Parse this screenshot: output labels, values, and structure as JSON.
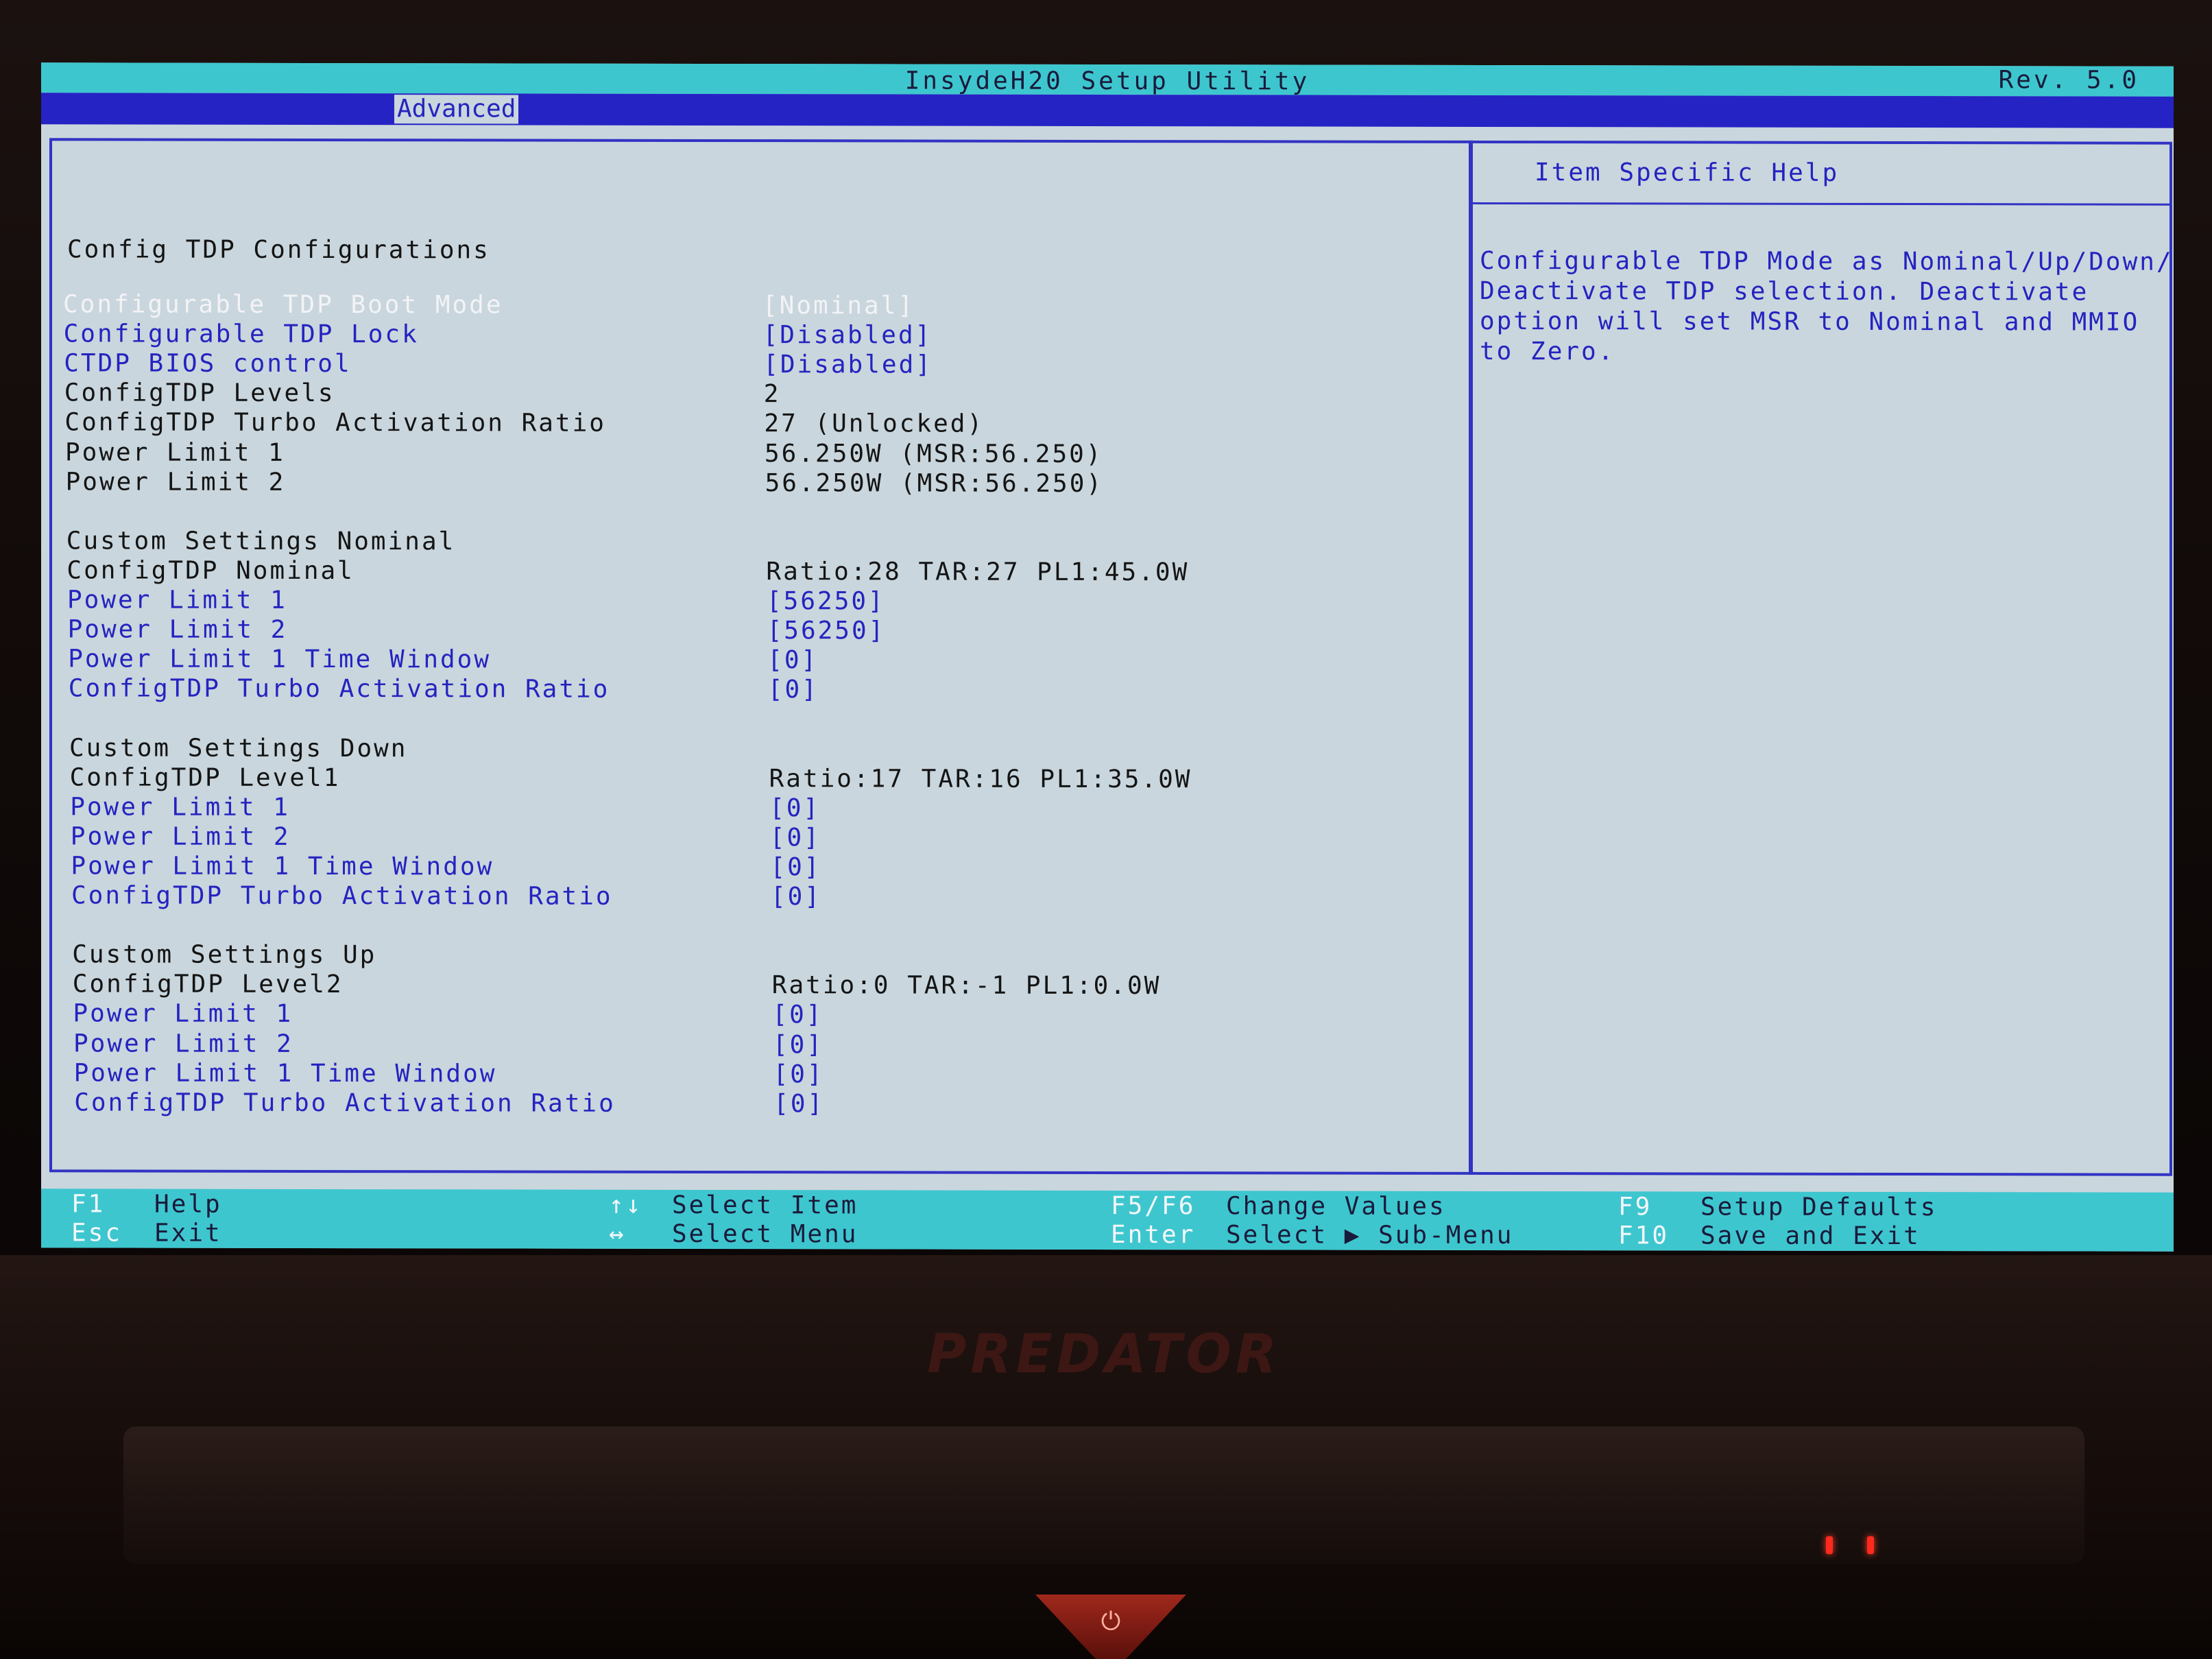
{
  "window": {
    "title": "InsydeH20 Setup Utility",
    "revision": "Rev. 5.0"
  },
  "menu": {
    "active_tab": "Advanced"
  },
  "main": {
    "section_title": "Config TDP Configurations",
    "rows": [
      {
        "label": "Configurable TDP Boot Mode",
        "value": "[Nominal]",
        "kind": "highlight"
      },
      {
        "label": "Configurable TDP Lock",
        "value": "[Disabled]",
        "kind": "option"
      },
      {
        "label": "CTDP BIOS control",
        "value": "[Disabled]",
        "kind": "option"
      },
      {
        "label": "ConfigTDP Levels",
        "value": "2",
        "kind": "info"
      },
      {
        "label": "ConfigTDP Turbo Activation Ratio",
        "value": "27 (Unlocked)",
        "kind": "info"
      },
      {
        "label": "Power Limit 1",
        "value": "56.250W (MSR:56.250)",
        "kind": "info"
      },
      {
        "label": "Power Limit 2",
        "value": "56.250W (MSR:56.250)",
        "kind": "info"
      },
      {
        "label": "",
        "value": "",
        "kind": "blank"
      },
      {
        "label": "Custom Settings Nominal",
        "value": "",
        "kind": "info"
      },
      {
        "label": "ConfigTDP Nominal",
        "value": "Ratio:28 TAR:27 PL1:45.0W",
        "kind": "info"
      },
      {
        "label": "Power Limit 1",
        "value": "[56250]",
        "kind": "option"
      },
      {
        "label": "Power Limit 2",
        "value": "[56250]",
        "kind": "option"
      },
      {
        "label": "Power Limit 1 Time Window",
        "value": "[0]",
        "kind": "option"
      },
      {
        "label": "ConfigTDP Turbo Activation Ratio",
        "value": "[0]",
        "kind": "option"
      },
      {
        "label": "",
        "value": "",
        "kind": "blank"
      },
      {
        "label": "Custom Settings Down",
        "value": "",
        "kind": "info"
      },
      {
        "label": "ConfigTDP Level1",
        "value": "Ratio:17 TAR:16 PL1:35.0W",
        "kind": "info"
      },
      {
        "label": "Power Limit 1",
        "value": "[0]",
        "kind": "option"
      },
      {
        "label": "Power Limit 2",
        "value": "[0]",
        "kind": "option"
      },
      {
        "label": "Power Limit 1 Time Window",
        "value": "[0]",
        "kind": "option"
      },
      {
        "label": "ConfigTDP Turbo Activation Ratio",
        "value": "[0]",
        "kind": "option"
      },
      {
        "label": "",
        "value": "",
        "kind": "blank"
      },
      {
        "label": "Custom Settings Up",
        "value": "",
        "kind": "info"
      },
      {
        "label": "ConfigTDP Level2",
        "value": "Ratio:0 TAR:-1 PL1:0.0W",
        "kind": "info"
      },
      {
        "label": "Power Limit 1",
        "value": "[0]",
        "kind": "option"
      },
      {
        "label": "Power Limit 2",
        "value": "[0]",
        "kind": "option"
      },
      {
        "label": "Power Limit 1 Time Window",
        "value": "[0]",
        "kind": "option"
      },
      {
        "label": "ConfigTDP Turbo Activation Ratio",
        "value": "[0]",
        "kind": "option"
      }
    ]
  },
  "help": {
    "title": "Item Specific Help",
    "lines": [
      "Configurable TDP Mode as Nominal/Up/Down/",
      "Deactivate TDP selection. Deactivate",
      "option will set MSR to Nominal and MMIO",
      "to Zero."
    ]
  },
  "footer": {
    "f1_key": "F1",
    "f1_label": "Help",
    "esc_key": "Esc",
    "esc_label": "Exit",
    "updown_key": "↑↓",
    "updown_label": "Select Item",
    "leftright_key": "↔",
    "leftright_label": "Select Menu",
    "f5f6_key": "F5/F6",
    "f5f6_label": "Change Values",
    "enter_key": "Enter",
    "enter_label": "Select ▶ Sub-Menu",
    "f9_key": "F9",
    "f9_label": "Setup Defaults",
    "f10_key": "F10",
    "f10_label": "Save and Exit"
  },
  "hardware": {
    "brand": "PREDATOR"
  },
  "colors": {
    "screen_bg": "#c9d6dd",
    "title_bar": "#3ec6cf",
    "menu_bar": "#2623c5",
    "option_text": "#2523c0",
    "info_text": "#141414",
    "highlight_text": "#f3f3f6"
  }
}
